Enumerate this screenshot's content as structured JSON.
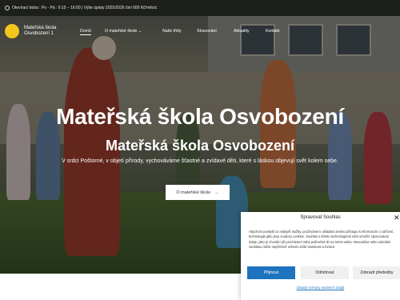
{
  "topbar": {
    "hours": "Otevírací doba : Po - Pá : 6:15 – 16:00 | Výše úplaty 2025/2026 činí 600 Kč/měsíc"
  },
  "header": {
    "logo_line1": "Mateřská škola",
    "logo_line2": "Osvobození 1",
    "nav": [
      {
        "label": "Domů",
        "active": true
      },
      {
        "label": "O mateřské škole ⌄"
      },
      {
        "label": "Naše třídy"
      },
      {
        "label": "Stravování"
      },
      {
        "label": "Aktuality"
      },
      {
        "label": "Kontakt"
      }
    ]
  },
  "hero": {
    "title": "Mateřská škola Osvobození",
    "subtitle": "Mateřská škola Osvobození",
    "lead": "V srdci Poštorné, v objetí přírody, vychováváme šťastné a zvídavé děti, které s láskou objevují svět kolem sebe.",
    "cta_label": "O mateřské škole",
    "cta_arrow": "→"
  },
  "cookie": {
    "title": "Spravovat Souhlas",
    "close": "✕",
    "text": "Abychom poskytli co nejlepší služby, používáme k ukládání a/nebo přístupu k informacím o zařízení, technologie jako jsou soubory cookies. Souhlas s těmito technologiemi nám umožní zpracovávat údaje, jako je chování při procházení nebo jedinečná ID na tomto webu. Nesouhlas nebo odvolání souhlasu může nepříznivě ovlivnit určité vlastnosti a funkce.",
    "accept": "Přijmout",
    "deny": "Odmítnout",
    "preferences": "Zobrazit předvolby",
    "policy_link": "Zásady ochrany osobních údajů"
  },
  "colors": {
    "accent": "#1e73be",
    "logo": "#f2c61a",
    "topbar": "#1d1f1c"
  }
}
